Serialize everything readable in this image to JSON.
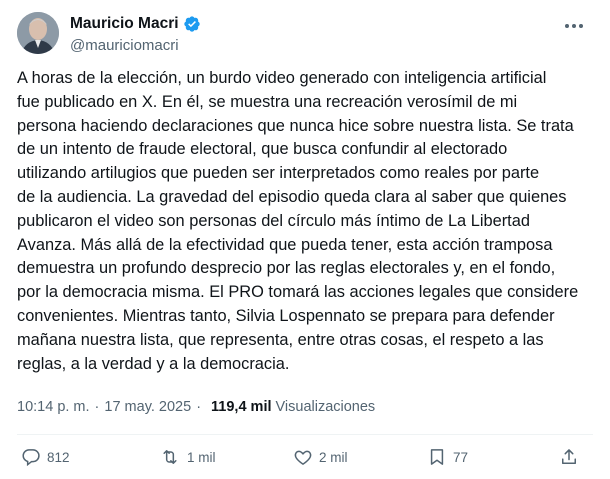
{
  "author": {
    "name": "Mauricio Macri",
    "handle": "@mauriciomacri",
    "verified_color": "#1d9bf0"
  },
  "icons": {
    "verified": "verified-badge-icon",
    "more": "more-options-icon",
    "reply": "reply-icon",
    "retweet": "retweet-icon",
    "like": "like-icon",
    "bookmark": "bookmark-icon",
    "share": "share-icon"
  },
  "tweet": {
    "text": "A horas de la elección, un burdo video generado con inteligencia artificial\nfue publicado en X. En él, se muestra una recreación verosímil de mi\npersona haciendo declaraciones que nunca hice sobre nuestra lista. Se trata\nde un intento de fraude electoral, que busca confundir al electorado\nutilizando artilugios que pueden ser interpretados como reales por parte\nde la audiencia. La gravedad del episodio queda clara al saber que quienes\npublicaron el video son personas del círculo más íntimo de La Libertad\nAvanza. Más allá de la efectividad que pueda tener, esta acción tramposa\ndemuestra un profundo desprecio por las reglas electorales y, en el fondo,\npor la democracia misma. El PRO tomará las acciones legales que considere\nconvenientes. Mientras tanto, Silvia Lospennato se prepara para defender\nmañana nuestra lista, que representa, entre otras cosas, el respeto a las\nreglas, a la verdad y a la democracia.",
    "time": "10:14 p. m.",
    "separator": "·",
    "date": "17 may. 2025",
    "views_count": "119,4 mil",
    "views_label": "Visualizaciones"
  },
  "actions": {
    "replies": "812",
    "retweets": "1 mil",
    "likes": "2 mil",
    "bookmarks": "77"
  }
}
